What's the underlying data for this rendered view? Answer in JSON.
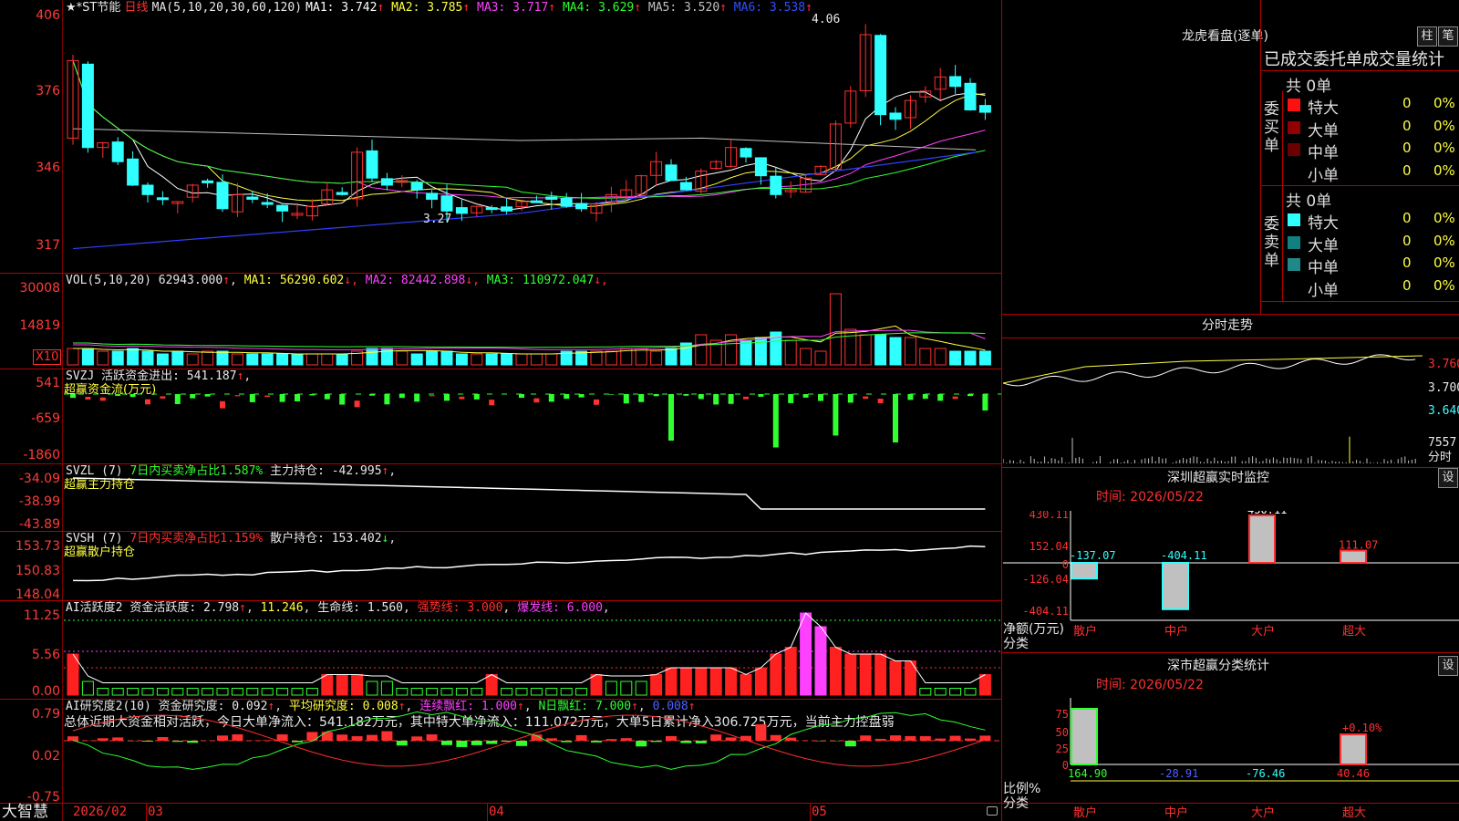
{
  "stock": {
    "name": "★*ST节能",
    "period": "日线"
  },
  "price_panel": {
    "axis": [
      "406",
      "376",
      "346",
      "317"
    ],
    "ma_label": "MA(5,10,20,30,60,120)",
    "ma": [
      {
        "name": "MA1:",
        "value": "3.742",
        "arrow": "↑",
        "color": "#ffffff"
      },
      {
        "name": "MA2:",
        "value": "3.785",
        "arrow": "↑",
        "color": "#ffff40"
      },
      {
        "name": "MA3:",
        "value": "3.717",
        "arrow": "↑",
        "color": "#ff40ff"
      },
      {
        "name": "MA4:",
        "value": "3.629",
        "arrow": "↑",
        "color": "#30ff30"
      },
      {
        "name": "MA5:",
        "value": "3.520",
        "arrow": "↑",
        "color": "#c0c0c0"
      },
      {
        "name": "MA6:",
        "value": "3.538",
        "arrow": "↑",
        "color": "#3050ff"
      }
    ],
    "high_label": "4.06",
    "low_label": "3.27"
  },
  "vol_panel": {
    "axis": [
      "30008",
      "14819"
    ],
    "multiplier": "X10",
    "title": "VOL(5,10,20)",
    "value": "62943.000",
    "ma": [
      {
        "name": "MA1:",
        "value": "56290.602",
        "arrow": "↓",
        "color": "#ffff40"
      },
      {
        "name": "MA2:",
        "value": "82442.898",
        "arrow": "↓",
        "color": "#ff40ff"
      },
      {
        "name": "MA3:",
        "value": "110972.047",
        "arrow": "↓",
        "color": "#30ff30"
      }
    ]
  },
  "svzj": {
    "axis": [
      "541",
      "-659",
      "-1860"
    ],
    "title": "SVZJ",
    "label": "活跃资金进出:",
    "value": "541.187",
    "arrow": "↑",
    "sub": "超赢资金流(万元)"
  },
  "svzl": {
    "axis": [
      "-34.09",
      "-38.99",
      "-43.89"
    ],
    "title": "SVZL (7)",
    "ratio": "7日内买卖净占比1.587%",
    "label": "主力持仓:",
    "value": "-42.995",
    "arrow": "↑",
    "sub": "超赢主力持仓"
  },
  "svsh": {
    "axis": [
      "153.73",
      "150.83",
      "148.04"
    ],
    "title": "SVSH (7)",
    "ratio": "7日内买卖净占比1.159%",
    "label": "散户持仓:",
    "value": "153.402",
    "arrow": "↓",
    "sub": "超赢散户持仓"
  },
  "ai_active": {
    "axis": [
      "11.25",
      "5.56",
      "0.00"
    ],
    "title": "AI活跃度2",
    "label": "资金活跃度:",
    "value": "2.798",
    "arrow": "↑",
    "v2": "11.246",
    "life_label": "生命线:",
    "life": "1.560",
    "strong_label": "强势线:",
    "strong": "3.000",
    "burst_label": "爆发线:",
    "burst": "6.000"
  },
  "ai_research": {
    "axis": [
      "0.79",
      "0.02",
      "-0.75"
    ],
    "title": "AI研究度2(10)",
    "label": "资金研究度:",
    "value": "0.092",
    "arrow": "↑",
    "avg_label": "平均研究度:",
    "avg": "0.008",
    "lx_label": "连续飘红:",
    "lx": "1.000",
    "n_label": "N日飘红:",
    "n": "7.000",
    "last": "0.008",
    "summary": "总体近期大资金相对活跃，今日大单净流入：541.182万元，其中特大单净流入：111.072万元，大单5日累计净入306.725万元，当前主力控盘弱"
  },
  "timeline": {
    "brand": "大智慧",
    "dates": [
      "2026/02",
      "03",
      "04",
      "05"
    ]
  },
  "dragon": {
    "title": "龙虎看盘(逐单)",
    "btn1": "柱",
    "btn2": "笔",
    "subtitle": "已成交委托单成交量统计",
    "buy_side": "委买单",
    "sell_side": "委卖单",
    "buy_total": "共 0单",
    "sell_total": "共 0单",
    "rows_buy": [
      {
        "label": "特大",
        "n": "0",
        "pct": "0%",
        "color": "#ff1010"
      },
      {
        "label": "大单",
        "n": "0",
        "pct": "0%",
        "color": "#900000"
      },
      {
        "label": "中单",
        "n": "0",
        "pct": "0%",
        "color": "#6a0000"
      },
      {
        "label": "小单",
        "n": "0",
        "pct": "0%",
        "color": "#000000"
      }
    ],
    "rows_sell": [
      {
        "label": "特大",
        "n": "0",
        "pct": "0%",
        "color": "#30ffff"
      },
      {
        "label": "大单",
        "n": "0",
        "pct": "0%",
        "color": "#108080"
      },
      {
        "label": "中单",
        "n": "0",
        "pct": "0%",
        "color": "#208888"
      },
      {
        "label": "小单",
        "n": "0",
        "pct": "0%",
        "color": "#000000"
      }
    ]
  },
  "intraday": {
    "title": "分时走势",
    "p1": "3.760",
    "p2": "3.700",
    "p3": "3.640",
    "vol": "7557",
    "vol_label": "分时"
  },
  "sz_monitor": {
    "title": "深圳超赢实时监控",
    "btn": "设",
    "time": "时间: 2026/05/22",
    "axis": [
      "430.11",
      "152.04",
      "0",
      "-126.04",
      "-404.11"
    ],
    "y_label": "净额(万元)",
    "x_label": "分类",
    "cats": [
      "散户",
      "中户",
      "大户",
      "超大"
    ],
    "values": [
      "-137.07",
      "-404.11",
      "430.11",
      "111.07"
    ]
  },
  "sz_stats": {
    "title": "深市超赢分类统计",
    "btn": "设",
    "time": "时间: 2026/05/22",
    "axis": [
      "75",
      "50",
      "25",
      "0"
    ],
    "y_label": "比例%",
    "x_label": "分类",
    "cats": [
      "散户",
      "中户",
      "大户",
      "超大"
    ],
    "values": [
      "164.90",
      "-28.91",
      "-76.46",
      "40.46"
    ],
    "pct": "+0.10%"
  },
  "chart_data": [
    {
      "type": "bar",
      "title": "深圳超赢实时监控",
      "xlabel": "分类",
      "ylabel": "净额(万元)",
      "categories": [
        "散户",
        "中户",
        "大户",
        "超大"
      ],
      "values": [
        -137.07,
        -404.11,
        430.11,
        111.07
      ],
      "ylim": [
        -404.11,
        430.11
      ]
    },
    {
      "type": "bar",
      "title": "深市超赢分类统计",
      "xlabel": "分类",
      "ylabel": "比例%",
      "categories": [
        "散户",
        "中户",
        "大户",
        "超大"
      ],
      "values": [
        164.9,
        -28.91,
        -76.46,
        40.46
      ],
      "ylim": [
        0,
        75
      ]
    }
  ]
}
